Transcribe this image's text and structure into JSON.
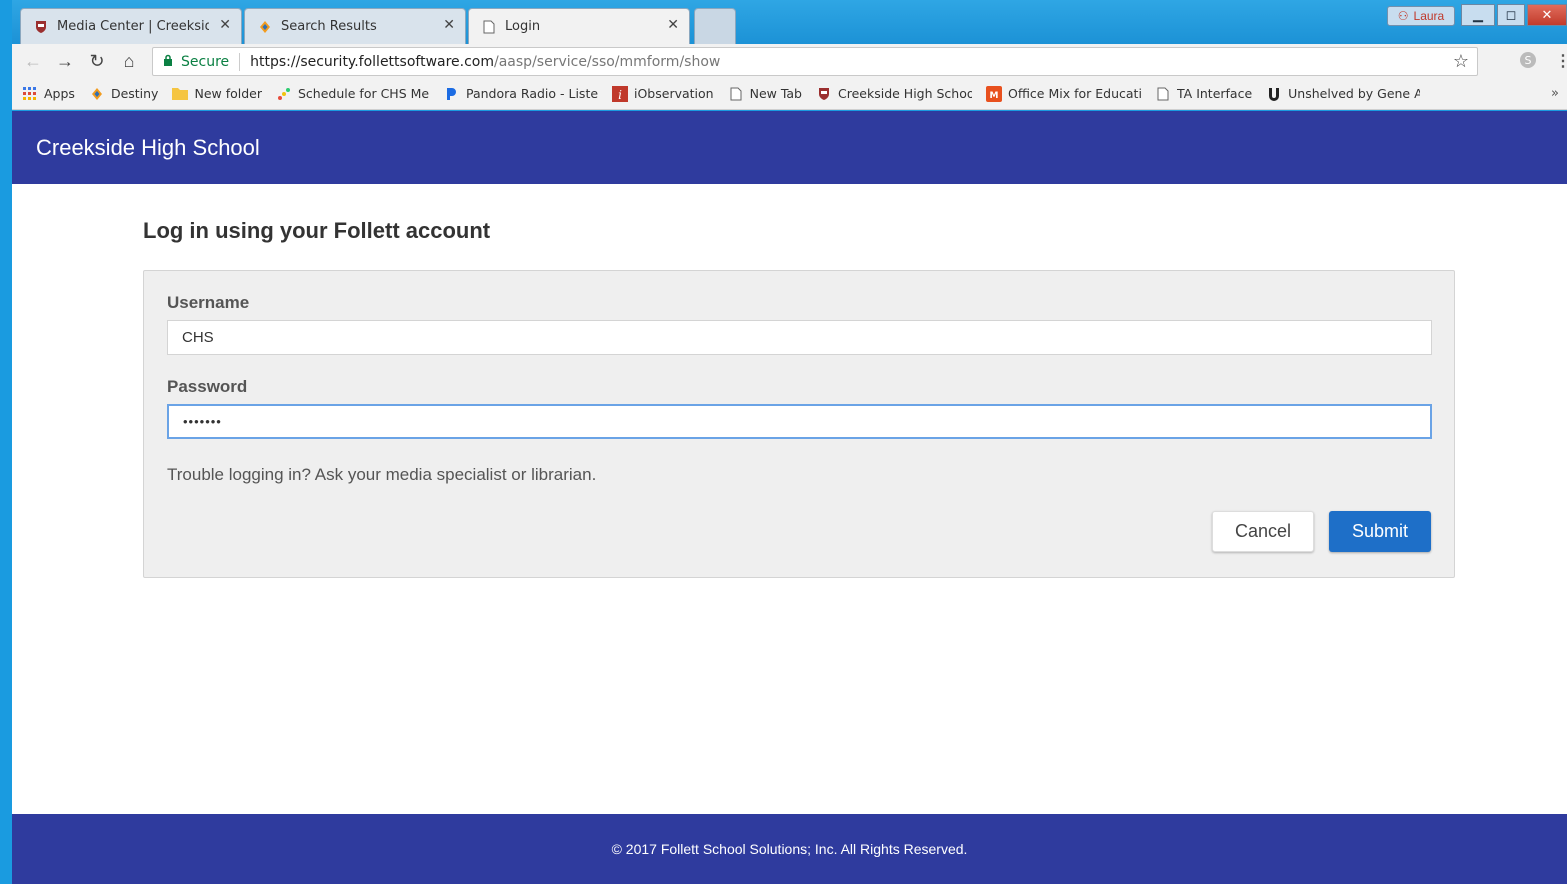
{
  "browser": {
    "tabs": [
      {
        "title": "Media Center | Creekside",
        "icon": "crest-icon",
        "active": false
      },
      {
        "title": "Search Results",
        "icon": "destiny-icon",
        "active": false
      },
      {
        "title": "Login",
        "icon": "page-icon",
        "active": true
      }
    ],
    "profile_name": "Laura",
    "address": {
      "secure_label": "Secure",
      "host": "https://security.follettsoftware.com",
      "path": "/aasp/service/sso/mmform/show"
    },
    "bookmarks": [
      {
        "label": "Apps",
        "icon": "apps-grid-icon"
      },
      {
        "label": "Destiny",
        "icon": "destiny-icon"
      },
      {
        "label": "New folder",
        "icon": "folder-icon"
      },
      {
        "label": "Schedule for CHS Me",
        "icon": "schedule-icon"
      },
      {
        "label": "Pandora Radio - Lister",
        "icon": "pandora-icon"
      },
      {
        "label": "iObservation",
        "icon": "iobservation-icon"
      },
      {
        "label": "New Tab",
        "icon": "page-icon"
      },
      {
        "label": "Creekside High Schoo",
        "icon": "crest-icon"
      },
      {
        "label": "Office Mix for Educati",
        "icon": "office-mix-icon"
      },
      {
        "label": "TA Interface",
        "icon": "page-icon"
      },
      {
        "label": "Unshelved by Gene A",
        "icon": "unshelved-icon"
      }
    ],
    "more_bookmarks": "»"
  },
  "site": {
    "title": "Creekside High School",
    "colors": {
      "header": "#2f3b9e",
      "submit": "#1e6fc8"
    }
  },
  "login": {
    "heading": "Log in using your Follett account",
    "username_label": "Username",
    "username_value": "CHS",
    "password_label": "Password",
    "password_value": "•••••••",
    "help_text": "Trouble logging in? Ask your media specialist or librarian.",
    "cancel_label": "Cancel",
    "submit_label": "Submit"
  },
  "footer": {
    "copyright": "© 2017 Follett School Solutions; Inc. All Rights Reserved."
  }
}
